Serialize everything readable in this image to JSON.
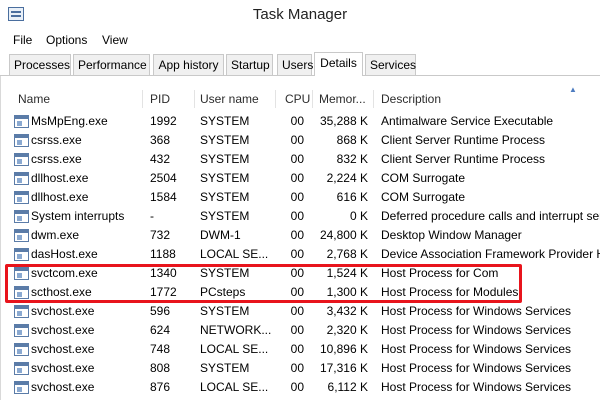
{
  "window": {
    "title": "Task Manager"
  },
  "menu": [
    "File",
    "Options",
    "View"
  ],
  "tabs": [
    "Processes",
    "Performance",
    "App history",
    "Startup",
    "Users",
    "Details",
    "Services"
  ],
  "active_tab": "Details",
  "columns": [
    "Name",
    "PID",
    "User name",
    "CPU",
    "Memor...",
    "Description"
  ],
  "rows": [
    [
      "MsMpEng.exe",
      "1992",
      "SYSTEM",
      "00",
      "35,288 K",
      "Antimalware Service Executable"
    ],
    [
      "csrss.exe",
      "368",
      "SYSTEM",
      "00",
      "868 K",
      "Client Server Runtime Process"
    ],
    [
      "csrss.exe",
      "432",
      "SYSTEM",
      "00",
      "832 K",
      "Client Server Runtime Process"
    ],
    [
      "dllhost.exe",
      "2504",
      "SYSTEM",
      "00",
      "2,224 K",
      "COM Surrogate"
    ],
    [
      "dllhost.exe",
      "1584",
      "SYSTEM",
      "00",
      "616 K",
      "COM Surrogate"
    ],
    [
      "System interrupts",
      "-",
      "SYSTEM",
      "00",
      "0 K",
      "Deferred procedure calls and interrupt serv"
    ],
    [
      "dwm.exe",
      "732",
      "DWM-1",
      "00",
      "24,800 K",
      "Desktop Window Manager"
    ],
    [
      "dasHost.exe",
      "1188",
      "LOCAL SE...",
      "00",
      "2,768 K",
      "Device Association Framework Provider H"
    ],
    [
      "svctcom.exe",
      "1340",
      "SYSTEM",
      "00",
      "1,524 K",
      "Host Process for Com"
    ],
    [
      "scthost.exe",
      "1772",
      "PCsteps",
      "00",
      "1,300 K",
      "Host Process for Modules"
    ],
    [
      "svchost.exe",
      "596",
      "SYSTEM",
      "00",
      "3,432 K",
      "Host Process for Windows Services"
    ],
    [
      "svchost.exe",
      "624",
      "NETWORK...",
      "00",
      "2,320 K",
      "Host Process for Windows Services"
    ],
    [
      "svchost.exe",
      "748",
      "LOCAL SE...",
      "00",
      "10,896 K",
      "Host Process for Windows Services"
    ],
    [
      "svchost.exe",
      "808",
      "SYSTEM",
      "00",
      "17,316 K",
      "Host Process for Windows Services"
    ],
    [
      "svchost.exe",
      "876",
      "LOCAL SE...",
      "00",
      "6,112 K",
      "Host Process for Windows Services"
    ]
  ],
  "highlighted_rows": [
    8,
    9
  ],
  "colors": {
    "highlight": "#e8141c",
    "icon": "#5b7ca8"
  }
}
